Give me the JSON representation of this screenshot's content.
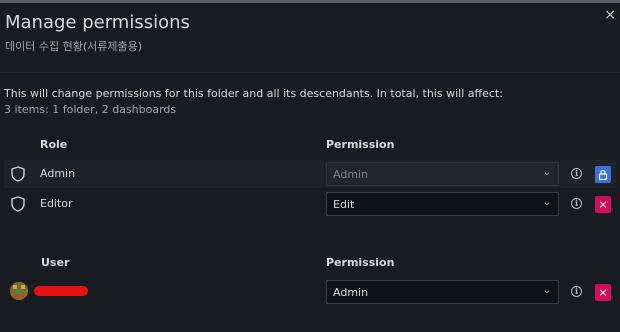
{
  "dialog": {
    "title": "Manage permissions",
    "folder_name": "데이터 수집 현황(서류제출용)",
    "close_icon": "×",
    "info_line": "This will change permissions for this folder and all its descendants. In total, this will affect:",
    "info_counts": "3 items: 1 folder, 2 dashboards"
  },
  "roles_section": {
    "role_header": "Role",
    "permission_header": "Permission",
    "rows": [
      {
        "name": "Admin",
        "permission": "Admin",
        "disabled": true,
        "action_icon": "lock-icon"
      },
      {
        "name": "Editor",
        "permission": "Edit",
        "disabled": false,
        "action_icon": "close-icon"
      }
    ]
  },
  "users_section": {
    "user_header": "User",
    "permission_header": "Permission",
    "rows": [
      {
        "name": "",
        "permission": "Admin",
        "disabled": false,
        "action_icon": "close-icon"
      }
    ]
  },
  "icons": {
    "chevron": "⌄",
    "info": "i",
    "remove": "×"
  },
  "colors": {
    "background": "#181b1f",
    "lock_button": "#3d71d9",
    "remove_button": "#d10e5c"
  }
}
